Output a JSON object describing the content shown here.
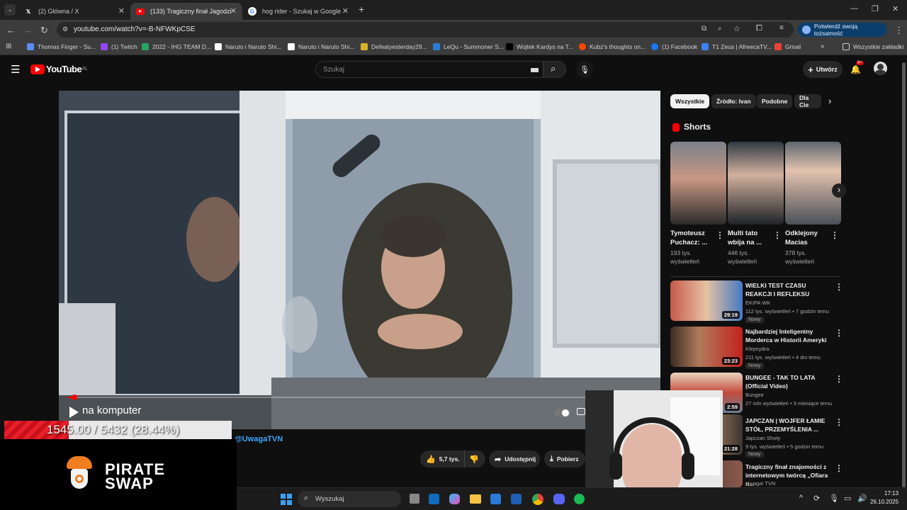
{
  "browser": {
    "tabs": [
      {
        "title": "(2) Główna / X",
        "icon": "x-logo-icon"
      },
      {
        "title": "(133) Tragiczny finał Jagodziank",
        "icon": "youtube-icon"
      },
      {
        "title": "hog rider - Szukaj w Google",
        "icon": "google-icon"
      }
    ],
    "new_tab": "+",
    "url": "youtube.com/watch?v=-B-NFWKpCSE",
    "verify_label": "Potwierdź swoją tożsamość",
    "bookmarks": [
      "Thomas Finger - Su...",
      "(1) Twitch",
      "2022 - IHG TEAM D...",
      "Naruto i Naruto Shi...",
      "Naruto i Naruto Shi...",
      "Defeatyesterday29...",
      "LeQu - Summoner S...",
      "Wojtek Kardys na T...",
      "Kubz's thoughts on...",
      "(1) Facebook",
      "T1 Zeus | AfreecaTV...",
      "Gmail"
    ],
    "all_bookmarks": "Wszystkie zakładki"
  },
  "youtube": {
    "logo": "YouTube",
    "region": "PL",
    "search_placeholder": "Szukaj",
    "create_label": "Utwórz",
    "notif_count": "9+"
  },
  "video": {
    "channel": "@UwagaTVN",
    "overlay_caption": "na komputer",
    "progress": 0.015,
    "likes": "5,7 tys.",
    "share_label": "Udostępnij",
    "download_label": "Pobierz"
  },
  "sidebar": {
    "chips": [
      "Wszystkie",
      "Źródło: Ivan",
      "Podobne",
      "Dla Cie"
    ],
    "shorts_heading": "Shorts",
    "shorts": [
      {
        "title": "Tymoteusz Puchacz: ...",
        "views": "193 tys. wyświetleń"
      },
      {
        "title": "Multi tato wbija na ...",
        "views": "446 tys. wyświetleń"
      },
      {
        "title": "Odklejony Macias",
        "views": "378 tys. wyświetleń"
      }
    ],
    "videos": [
      {
        "title": "WIELKI TEST CZASU REAKCJI I REFLEKSU",
        "channel": "EKIPA WK",
        "meta": "112 tys. wyświetleń • 7 godzin temu",
        "badge": "Nowy",
        "duration": "29:19"
      },
      {
        "title": "Najbardziej Inteligentny Morderca w Historii Ameryki",
        "channel": "Klepsydra",
        "meta": "211 tys. wyświetleń • 4 dni temu",
        "badge": "Nowy",
        "duration": "23:23"
      },
      {
        "title": "BUNGEE - TAK TO LATA (Official Video)",
        "channel": "Bungee",
        "meta": "27 mln wyświetleń • 3 miesiące temu",
        "badge": "",
        "duration": "2:59"
      },
      {
        "title": "JAPCZAN | WOJFER ŁAMIE STÓŁ, PRZEMYŚLENIA ...",
        "channel": "Japczan Shoty",
        "meta": "9 tys. wyświetleń • 5 godzin temu",
        "badge": "Nowy",
        "duration": "21:28"
      },
      {
        "title": "Tragiczny finał znajomości z internetowym twórcą „Ofiara n...",
        "channel": "Uwaga! TVN",
        "meta": "",
        "badge": "",
        "duration": ""
      }
    ]
  },
  "stream_overlay": {
    "counter": "1545.00 / 5432 (28.44%)",
    "counter_progress": 0.2844,
    "sponsor_line1": "PIRATE",
    "sponsor_line2": "SWAP"
  },
  "taskbar": {
    "search_placeholder": "Wyszukaj",
    "time": "17:13",
    "date": "26.10.2025"
  },
  "colors": {
    "youtube_red": "#ff0000",
    "bg": "#0f0f0f",
    "counter_red": "#e8202a"
  }
}
